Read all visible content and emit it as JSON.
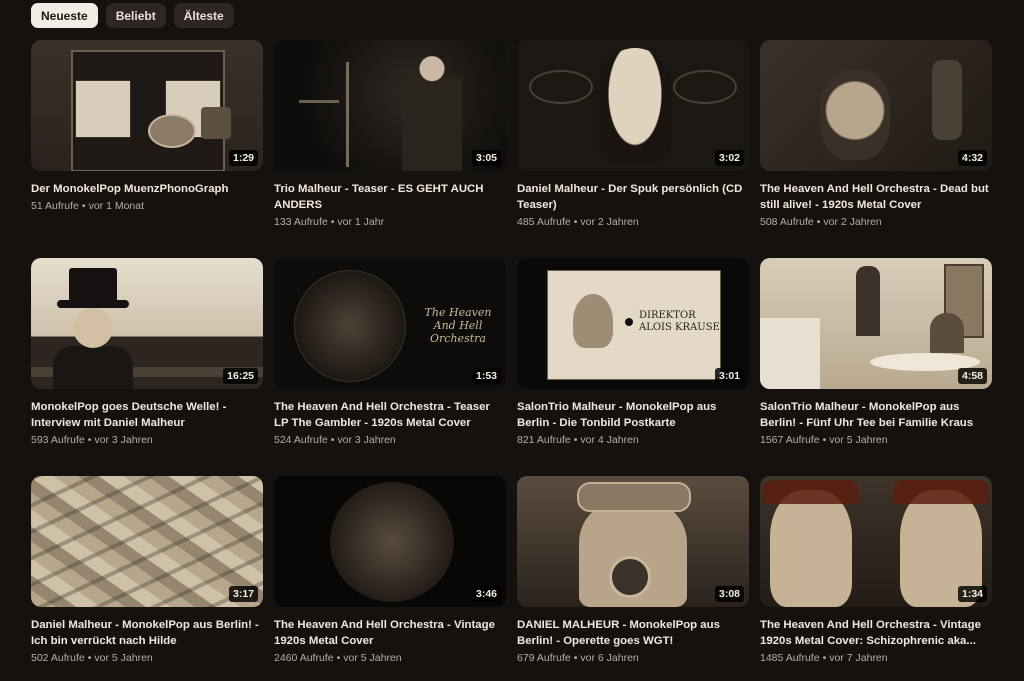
{
  "filters": {
    "items": [
      {
        "label": "Neueste",
        "active": true
      },
      {
        "label": "Beliebt",
        "active": false
      },
      {
        "label": "Älteste",
        "active": false
      }
    ]
  },
  "videos": [
    {
      "title": "Der MonokelPop MuenzPhonoGraph",
      "views": "51 Aufrufe",
      "age": "vor 1 Monat",
      "duration": "1:29"
    },
    {
      "title": "Trio Malheur - Teaser - ES GEHT AUCH ANDERS",
      "views": "133 Aufrufe",
      "age": "vor 1 Jahr",
      "duration": "3:05"
    },
    {
      "title": "Daniel Malheur - Der Spuk persönlich (CD Teaser)",
      "views": "485 Aufrufe",
      "age": "vor 2 Jahren",
      "duration": "3:02"
    },
    {
      "title": "The Heaven And Hell Orchestra - Dead but still alive! - 1920s Metal Cover",
      "views": "508 Aufrufe",
      "age": "vor 2 Jahren",
      "duration": "4:32"
    },
    {
      "title": "MonokelPop goes Deutsche Welle! - Interview mit Daniel Malheur",
      "views": "593 Aufrufe",
      "age": "vor 3 Jahren",
      "duration": "16:25"
    },
    {
      "title": "The Heaven And Hell Orchestra - Teaser LP The Gambler - 1920s Metal Cover",
      "views": "524 Aufrufe",
      "age": "vor 3 Jahren",
      "duration": "1:53"
    },
    {
      "title": "SalonTrio Malheur - MonokelPop aus Berlin - Die Tonbild Postkarte",
      "views": "821 Aufrufe",
      "age": "vor 4 Jahren",
      "duration": "3:01"
    },
    {
      "title": "SalonTrio Malheur - MonokelPop aus Berlin! - Fünf Uhr Tee bei Familie Kraus",
      "views": "1567 Aufrufe",
      "age": "vor 5 Jahren",
      "duration": "4:58"
    },
    {
      "title": "Daniel Malheur - MonokelPop aus Berlin! - Ich bin verrückt nach Hilde",
      "views": "502 Aufrufe",
      "age": "vor 5 Jahren",
      "duration": "3:17"
    },
    {
      "title": "The Heaven And Hell Orchestra - Vintage 1920s Metal Cover",
      "views": "2460 Aufrufe",
      "age": "vor 5 Jahren",
      "duration": "3:46"
    },
    {
      "title": "DANIEL MALHEUR - MonokelPop aus Berlin! - Operette goes WGT!",
      "views": "679 Aufrufe",
      "age": "vor 6 Jahren",
      "duration": "3:08"
    },
    {
      "title": "The Heaven And Hell Orchestra - Vintage 1920s Metal Cover: Schizophrenic aka...",
      "views": "1485 Aufrufe",
      "age": "vor 7 Jahren",
      "duration": "1:34"
    }
  ],
  "thumb_text": {
    "hh_logo": "The Heaven And Hell Orchestra",
    "postcard_line1": "DIREKTOR",
    "postcard_line2": "ALOIS KRAUSE"
  },
  "separator": "•"
}
